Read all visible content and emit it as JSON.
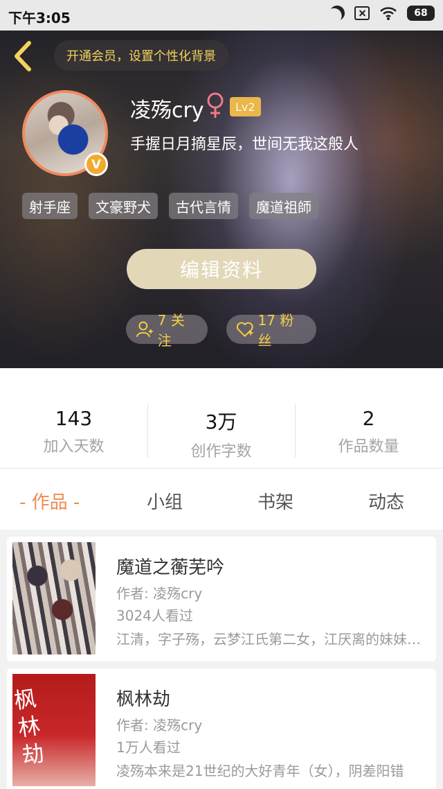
{
  "status_bar": {
    "time": "下午3:05",
    "battery": "68"
  },
  "header": {
    "vip_banner": "开通会员，设置个性化背景",
    "avatar_badge": "V"
  },
  "profile": {
    "username": "凌殇cry",
    "gender": "female",
    "level": "Lv2",
    "motto": "手握日月摘星辰，世间无我这般人",
    "tags": [
      "射手座",
      "文豪野犬",
      "古代言情",
      "魔道祖師"
    ],
    "edit_button": "编辑资料",
    "follow_label": "7 关注",
    "fans_label": "17 粉丝"
  },
  "stats": [
    {
      "value": "143",
      "label": "加入天数"
    },
    {
      "value": "3万",
      "label": "创作字数"
    },
    {
      "value": "2",
      "label": "作品数量"
    }
  ],
  "tabs": [
    "- 作品 -",
    "小组",
    "书架",
    "动态"
  ],
  "works": [
    {
      "title": "魔道之蘅芜吟",
      "author": "作者: 凌殇cry",
      "views": "3024人看过",
      "description": "江清，字子殇，云梦江氏第二女，江厌离的妹妹，江澄的姐姐"
    },
    {
      "title": "枫林劫",
      "author": "作者: 凌殇cry",
      "views": "1万人看过",
      "description": "凌殇本来是21世纪的大好青年（女），阴差阳错",
      "cover_text": "枫林劫"
    }
  ],
  "colors": {
    "accent": "#f08a50",
    "gold": "#f3cf45",
    "vip": "#f3d35c"
  }
}
